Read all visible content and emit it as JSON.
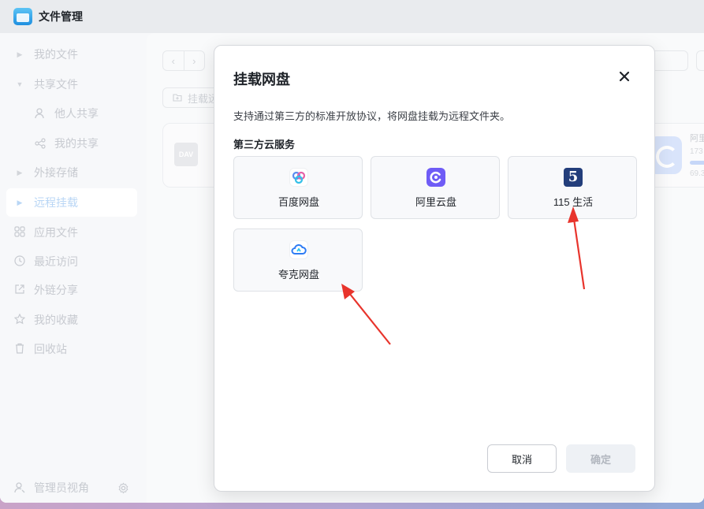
{
  "app": {
    "title": "文件管理",
    "accent": "#1f8fe0"
  },
  "sidebar": {
    "items": [
      {
        "label": "我的文件",
        "icon": "caret-right-icon"
      },
      {
        "label": "共享文件",
        "icon": "caret-down-icon"
      },
      {
        "label": "他人共享",
        "icon": "person-icon"
      },
      {
        "label": "我的共享",
        "icon": "share-icon"
      },
      {
        "label": "外接存储",
        "icon": "caret-right-icon"
      },
      {
        "label": "远程挂载",
        "icon": "caret-right-icon",
        "active": true
      },
      {
        "label": "应用文件",
        "icon": "grid-icon"
      },
      {
        "label": "最近访问",
        "icon": "clock-icon"
      },
      {
        "label": "外链分享",
        "icon": "link-share-icon"
      },
      {
        "label": "我的收藏",
        "icon": "star-icon"
      },
      {
        "label": "回收站",
        "icon": "trash-icon"
      }
    ],
    "footer": {
      "label": "管理员视角",
      "settings_icon": "gear-icon"
    }
  },
  "main": {
    "mount_chip": "挂载远",
    "left_card_badge": "DAV",
    "right_card": {
      "name": "阿里",
      "num1": "173",
      "num2": "69.3"
    }
  },
  "dialog": {
    "title": "挂载网盘",
    "description": "支持通过第三方的标准开放协议，将网盘挂载为远程文件夹。",
    "section_title": "第三方云服务",
    "services": [
      {
        "label": "百度网盘",
        "icon": "baidu-netdisk-icon"
      },
      {
        "label": "阿里云盘",
        "icon": "aliyun-drive-icon"
      },
      {
        "label": "115 生活",
        "icon": "115-life-icon"
      },
      {
        "label": "夸克网盘",
        "icon": "quark-netdisk-icon"
      }
    ],
    "cancel_label": "取消",
    "ok_label": "确定",
    "arrow_color": "#e8342c"
  }
}
